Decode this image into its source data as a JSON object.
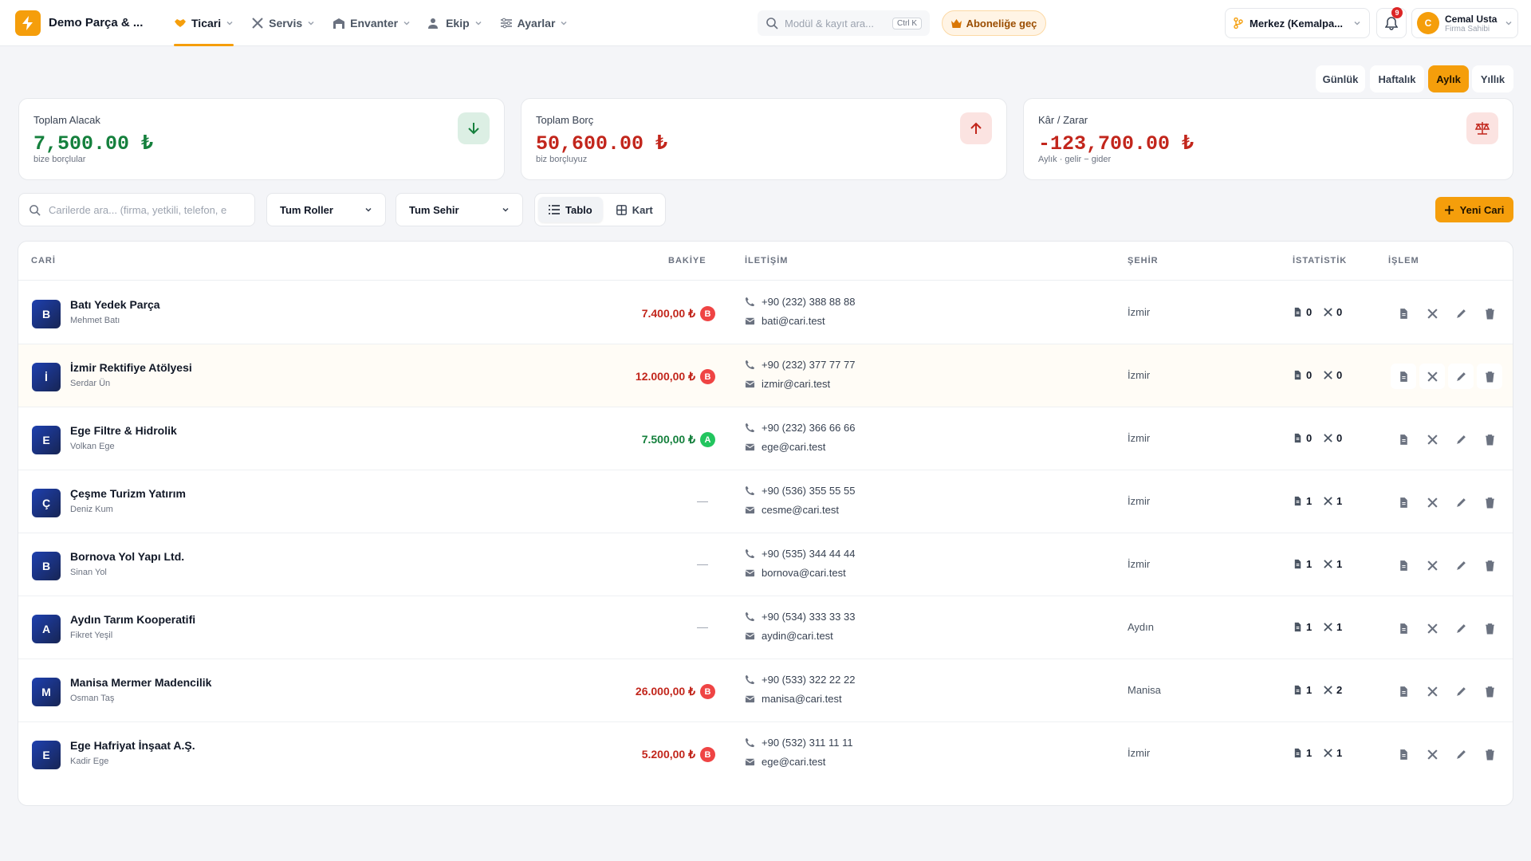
{
  "app": {
    "brand": "Demo Parça & ..."
  },
  "nav": [
    {
      "label": "Ticari",
      "icon": "handshake-icon",
      "active": true
    },
    {
      "label": "Servis",
      "icon": "tools-icon"
    },
    {
      "label": "Envanter",
      "icon": "warehouse-icon"
    },
    {
      "label": "Ekip",
      "icon": "team-icon"
    },
    {
      "label": "Ayarlar",
      "icon": "sliders-icon"
    }
  ],
  "search": {
    "placeholder": "Modül & kayıt ara...",
    "shortcut": "Ctrl K"
  },
  "subscribe": {
    "label": "Aboneliğe geç"
  },
  "branch": {
    "label": "Merkez (Kemalpa..."
  },
  "notifications": {
    "count": "9"
  },
  "user": {
    "initial": "C",
    "name": "Cemal Usta",
    "role": "Firma Sahibi"
  },
  "periods": [
    {
      "label": "Günlük"
    },
    {
      "label": "Haftalık"
    },
    {
      "label": "Aylık",
      "active": true
    },
    {
      "label": "Yıllık"
    }
  ],
  "summary": [
    {
      "label": "Toplam Alacak",
      "value": "7,500.00 ₺",
      "sub": "bize borçlular",
      "color": "#15803d",
      "icon": "arrow-down-icon"
    },
    {
      "label": "Toplam Borç",
      "value": "50,600.00 ₺",
      "sub": "biz borçluyuz",
      "color": "#c2261c",
      "icon": "arrow-up-icon"
    },
    {
      "label": "Kâr / Zarar",
      "value": "-123,700.00 ₺",
      "sub": "Aylık · gelir − gider",
      "color": "#c2261c",
      "icon": "scale-icon"
    }
  ],
  "filters": {
    "search_placeholder": "Carilerde ara... (firma, yetkili, telefon, e",
    "role": "Tum Roller",
    "city": "Tum Sehir",
    "view_table": "Tablo",
    "view_card": "Kart",
    "new_button": "Yeni Cari"
  },
  "table": {
    "headers": {
      "cari": "CARİ",
      "balance": "BAKİYE",
      "contact": "İLETİŞİM",
      "city": "ŞEHİR",
      "stats": "İSTATİSTİK",
      "actions": "İŞLEM"
    },
    "rows": [
      {
        "initial": "B",
        "name": "Batı Yedek Parça",
        "person": "Mehmet Batı",
        "balance": "7.400,00 ₺",
        "badge": "B",
        "phone": "+90 (232) 388 88 88",
        "email": "bati@cari.test",
        "city": "İzmir",
        "docs": "0",
        "services": "0"
      },
      {
        "initial": "İ",
        "name": "İzmir Rektifiye Atölyesi",
        "person": "Serdar Ün",
        "balance": "12.000,00 ₺",
        "badge": "B",
        "phone": "+90 (232) 377 77 77",
        "email": "izmir@cari.test",
        "city": "İzmir",
        "docs": "0",
        "services": "0"
      },
      {
        "initial": "E",
        "name": "Ege Filtre & Hidrolik",
        "person": "Volkan Ege",
        "balance": "7.500,00 ₺",
        "badge": "A",
        "phone": "+90 (232) 366 66 66",
        "email": "ege@cari.test",
        "city": "İzmir",
        "docs": "0",
        "services": "0"
      },
      {
        "initial": "Ç",
        "name": "Çeşme Turizm Yatırım",
        "person": "Deniz Kum",
        "balance": "—",
        "badge": "",
        "phone": "+90 (536) 355 55 55",
        "email": "cesme@cari.test",
        "city": "İzmir",
        "docs": "1",
        "services": "1"
      },
      {
        "initial": "B",
        "name": "Bornova Yol Yapı Ltd.",
        "person": "Sinan Yol",
        "balance": "—",
        "badge": "",
        "phone": "+90 (535) 344 44 44",
        "email": "bornova@cari.test",
        "city": "İzmir",
        "docs": "1",
        "services": "1"
      },
      {
        "initial": "A",
        "name": "Aydın Tarım Kooperatifi",
        "person": "Fikret Yeşil",
        "balance": "—",
        "badge": "",
        "phone": "+90 (534) 333 33 33",
        "email": "aydin@cari.test",
        "city": "Aydın",
        "docs": "1",
        "services": "1"
      },
      {
        "initial": "M",
        "name": "Manisa Mermer Madencilik",
        "person": "Osman Taş",
        "balance": "26.000,00 ₺",
        "badge": "B",
        "phone": "+90 (533) 322 22 22",
        "email": "manisa@cari.test",
        "city": "Manisa",
        "docs": "1",
        "services": "2"
      },
      {
        "initial": "E",
        "name": "Ege Hafriyat İnşaat A.Ş.",
        "person": "Kadir Ege",
        "balance": "5.200,00 ₺",
        "badge": "B",
        "phone": "+90 (532) 311 11 11",
        "email": "ege@cari.test",
        "city": "İzmir",
        "docs": "1",
        "services": "1"
      }
    ]
  },
  "colors": {
    "accent": "#f59e0b",
    "positive": "#15803d",
    "negative": "#c2261c",
    "badge_a": "#22c55e",
    "badge_b": "#ef4444"
  }
}
